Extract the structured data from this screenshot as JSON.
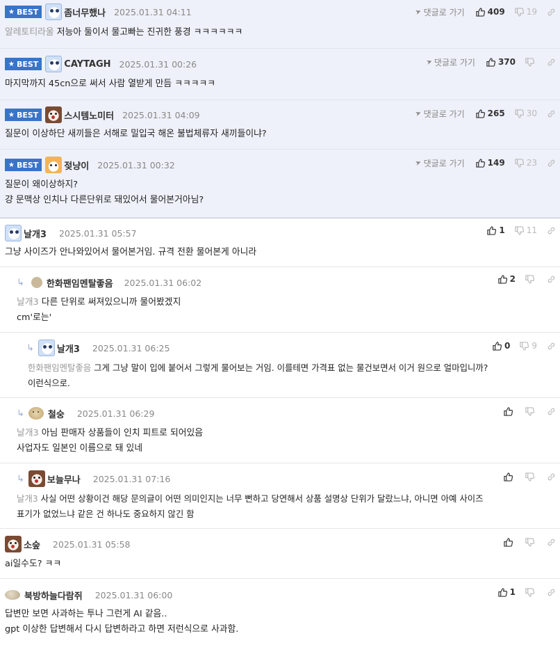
{
  "goto_label": "댓글로 가기",
  "best_label": "BEST",
  "comments": [
    {
      "best": true,
      "nick": "좀너무했나",
      "date": "2025.01.31 04:11",
      "up": "409",
      "down": "19",
      "mention": "알레토티라울",
      "lines": [
        "저능아 둘이서 물고빠는 진귀한 풍경 ㅋㅋㅋㅋㅋㅋ"
      ]
    },
    {
      "best": true,
      "nick": "CAYTAGH",
      "date": "2025.01.31 00:26",
      "up": "370",
      "down": "",
      "lines": [
        "마지막까지 45cn으로 써서 사람 열받게 만듬 ㅋㅋㅋㅋㅋ"
      ]
    },
    {
      "best": true,
      "nick": "스시템노미터",
      "date": "2025.01.31 04:09",
      "up": "265",
      "down": "30",
      "lines": [
        "질문이 이상하단 새끼들은 서해로 밀입국 해온 불법체류자 새끼들이냐?"
      ]
    },
    {
      "best": true,
      "nick": "젖냥이",
      "date": "2025.01.31 00:32",
      "up": "149",
      "down": "23",
      "lines": [
        "질문이 왜이상하지?",
        "걍 문맥상 인치나 다른단위로 돼있어서 물어본거아님?"
      ]
    },
    {
      "nick": "날개3",
      "date": "2025.01.31 05:57",
      "up": "1",
      "down": "11",
      "lines": [
        "그냥 사이즈가 안나와있어서 물어본거임. 규격 전환 물어본게 아니라"
      ]
    },
    {
      "nick": "한화팬임멘탈좋음",
      "date": "2025.01.31 06:02",
      "up": "2",
      "down": "",
      "mention": "날개3",
      "lines": [
        "다른 단위로 써져있으니까 물어봤겠지",
        "cm'로는'"
      ]
    },
    {
      "nick": "날개3",
      "date": "2025.01.31 06:25",
      "up": "0",
      "down": "9",
      "mention": "한화팬임멘탈좋음",
      "lines": [
        "그게 그냥 말이 입에 붙어서 그렇게 물어보는 거임. 이를테면 가격표 없는 물건보면서 이거 원으로 얼마입니까?",
        "이런식으로."
      ]
    },
    {
      "nick": "철숭",
      "date": "2025.01.31 06:29",
      "up": "",
      "down": "",
      "mention": "날개3",
      "lines": [
        "아님 판매자 상품들이 인치 피트로 되어있음",
        "사업자도 일본인 이름으로 돼 있네"
      ]
    },
    {
      "nick": "보늘무나",
      "date": "2025.01.31 07:16",
      "up": "",
      "down": "",
      "mention": "날개3",
      "lines": [
        "사실 어떤 상황이건 해당 문의글이 어떤 의미인지는 너무 뻔하고 당연해서 상품 설명상 단위가 달랐느냐, 아니면 아예 사이즈",
        "표기가 없었느냐 같은 건 하나도 중요하지 않긴 함"
      ]
    },
    {
      "nick": "소숲",
      "date": "2025.01.31 05:58",
      "up": "",
      "down": "",
      "lines": [
        "ai일수도? ㅋㅋ"
      ]
    },
    {
      "nick": "북방하늘다람쥐",
      "date": "2025.01.31 06:00",
      "up": "1",
      "down": "",
      "lines": [
        "답변만 보면 사과하는 투나 그런게 AI 같음..",
        "gpt 이상한 답변해서 다시 답변하라고 하면 저런식으로 사과함."
      ]
    }
  ]
}
